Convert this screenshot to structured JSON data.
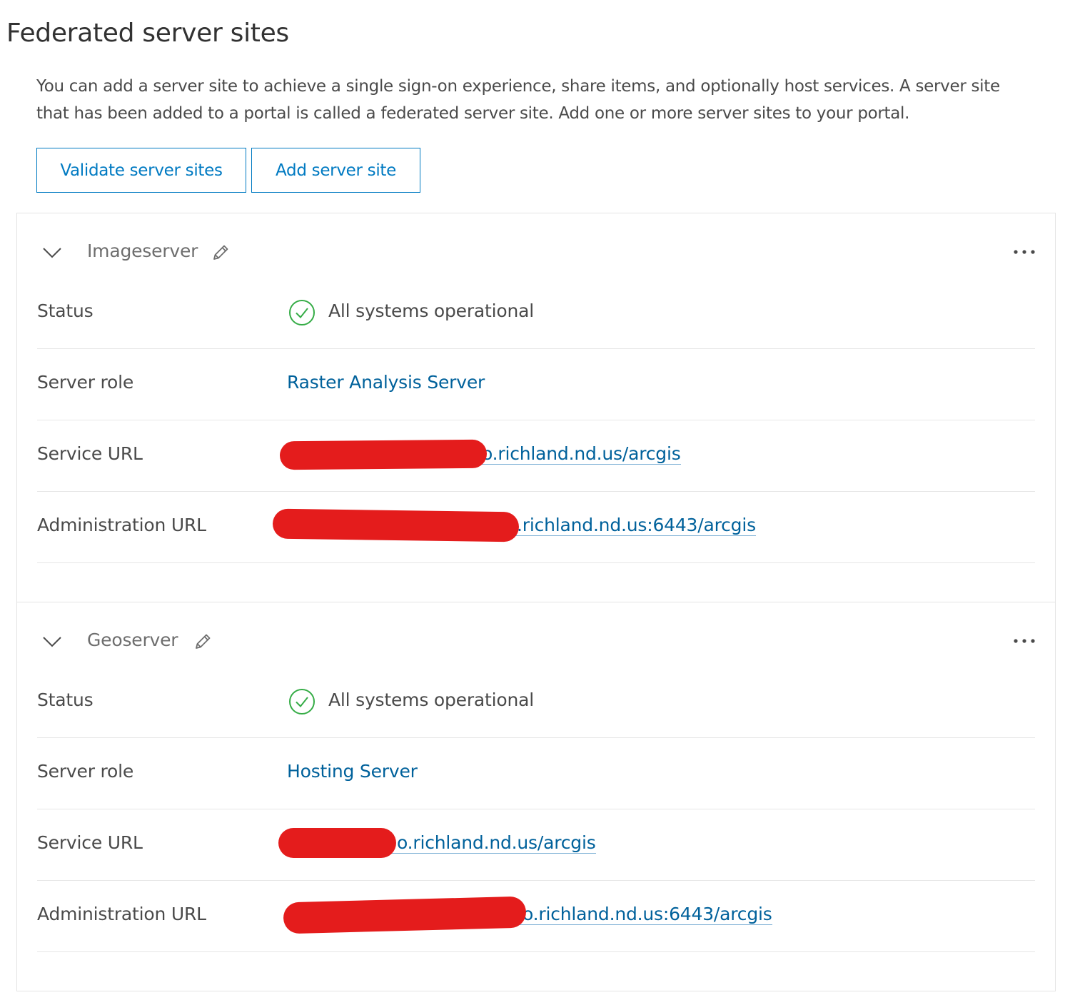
{
  "page": {
    "title": "Federated server sites",
    "description": "You can add a server site to achieve a single sign-on experience, share items, and optionally host services. A server site that has been added to a portal is called a federated server site. Add one or more server sites to your portal."
  },
  "buttons": {
    "validate": "Validate server sites",
    "add": "Add server site"
  },
  "labels": {
    "status": "Status",
    "server_role": "Server role",
    "service_url": "Service URL",
    "admin_url": "Administration URL"
  },
  "sites": [
    {
      "name": "Imageserver",
      "status": "All systems operational",
      "server_role": "Raster Analysis Server",
      "service_url_visible": "o.richland.nd.us/arcgis",
      "admin_url_visible": ".richland.nd.us:6443/arcgis"
    },
    {
      "name": "Geoserver",
      "status": "All systems operational",
      "server_role": "Hosting Server",
      "service_url_visible": "o.richland.nd.us/arcgis",
      "admin_url_visible": "o.richland.nd.us:6443/arcgis"
    }
  ],
  "icons": {
    "expand": "chevron-down-icon",
    "edit": "pencil-icon",
    "more": "ellipsis-icon",
    "status_ok": "check-circle-icon",
    "redaction": "red-redaction-marker"
  },
  "colors": {
    "accent": "#007ac2",
    "link": "#00619b",
    "success": "#35ac46",
    "redaction": "#e41c1c"
  }
}
